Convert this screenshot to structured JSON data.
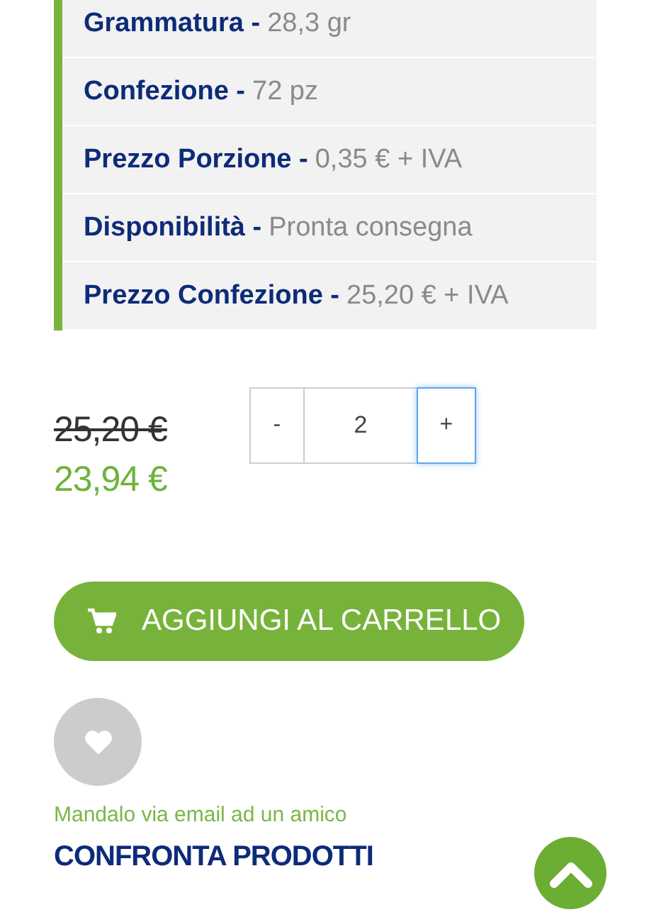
{
  "specs": [
    {
      "label": "Grammatura -",
      "value": "28,3 gr"
    },
    {
      "label": "Confezione -",
      "value": "72 pz"
    },
    {
      "label": "Prezzo Porzione -",
      "value": "0,35 € + IVA"
    },
    {
      "label": "Disponibilità -",
      "value": "Pronta consegna"
    },
    {
      "label": "Prezzo Confezione -",
      "value": "25,20 € + IVA"
    }
  ],
  "price": {
    "old": "25,20 €",
    "current": "23,94 €"
  },
  "quantity": {
    "minus": {
      "label": "-",
      "focused": false
    },
    "value": "2",
    "plus": {
      "label": "+",
      "focused": true
    }
  },
  "add_to_cart": "AGGIUNGI AL CARRELLO",
  "email_link": "Mandalo via email ad un amico",
  "compare_link": "CONFRONTA PRODOTTI"
}
